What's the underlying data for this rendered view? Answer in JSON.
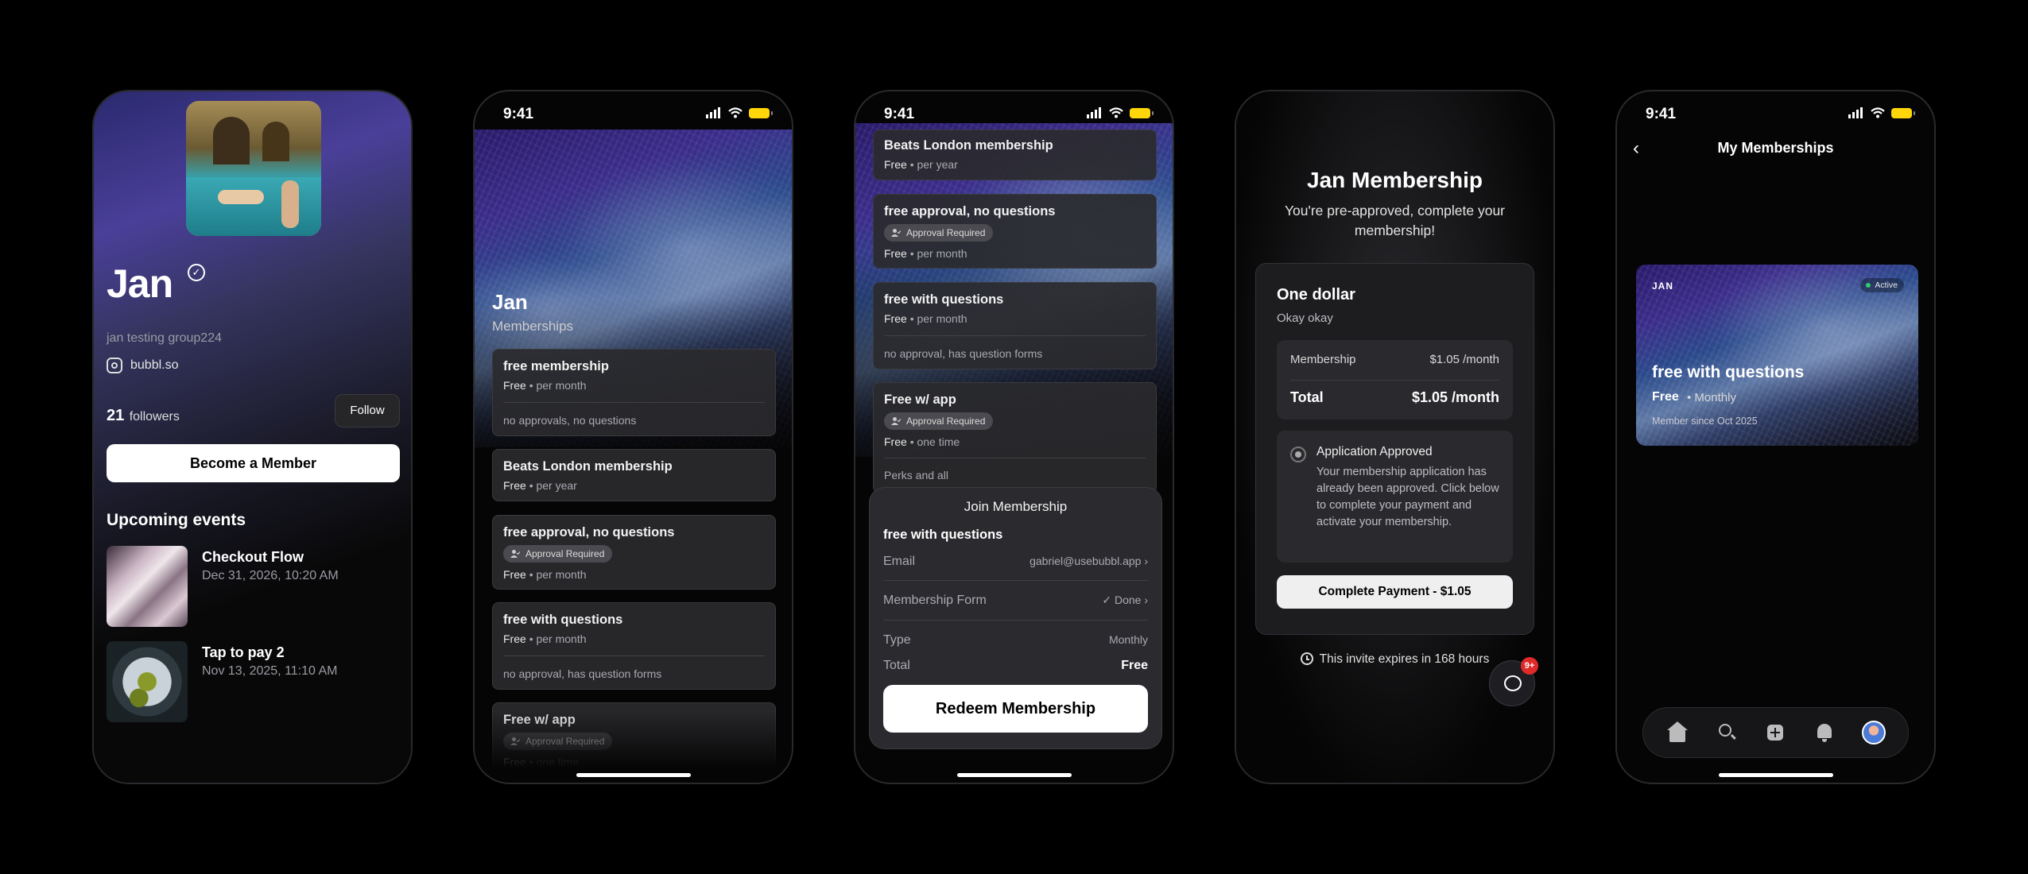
{
  "status": {
    "time": "9:41"
  },
  "profile": {
    "name": "Jan",
    "group": "jan testing group224",
    "link": "bubbl.so",
    "followers_count": "21",
    "followers_label": "followers",
    "follow_label": "Follow",
    "become_member_label": "Become a Member",
    "events_title": "Upcoming events",
    "events": [
      {
        "title": "Checkout Flow",
        "date": "Dec 31, 2026, 10:20 AM"
      },
      {
        "title": "Tap to pay 2",
        "date": "Nov 13, 2025, 11:10 AM"
      }
    ]
  },
  "memberships_page": {
    "title": "Jan",
    "subtitle": "Memberships",
    "plans": [
      {
        "name": "free membership",
        "price": "Free",
        "period": "• per month",
        "note": "no approvals, no questions"
      },
      {
        "name": "Beats London membership",
        "price": "Free",
        "period": "• per year"
      },
      {
        "name": "free approval, no questions",
        "badge": "Approval Required",
        "price": "Free",
        "period": "• per month"
      },
      {
        "name": "free with questions",
        "price": "Free",
        "period": "• per month",
        "note": "no approval, has question forms"
      },
      {
        "name": "Free w/ app",
        "badge": "Approval Required",
        "price": "Free",
        "period": "• one time",
        "note": "Perks and all"
      }
    ]
  },
  "join_sheet": {
    "title": "Join Membership",
    "plan": "free with questions",
    "email_label": "Email",
    "email_value": "gabriel@usebubbl.app",
    "form_label": "Membership Form",
    "form_value": "Done",
    "type_label": "Type",
    "type_value": "Monthly",
    "total_label": "Total",
    "total_value": "Free",
    "redeem_label": "Redeem Membership"
  },
  "checkout": {
    "title": "Jan Membership",
    "subtitle": "You're pre-approved, complete your membership!",
    "plan_name": "One dollar",
    "plan_desc": "Okay okay",
    "membership_label": "Membership",
    "membership_value": "$1.05 /month",
    "total_label": "Total",
    "total_value": "$1.05 /month",
    "approved_title": "Application Approved",
    "approved_body": "Your membership application has already been approved. Click below to complete your payment and activate your membership.",
    "pay_label": "Complete Payment - $1.05",
    "expire_text": "This invite expires in 168 hours",
    "notif_count": "9+"
  },
  "my_memberships": {
    "title": "My Memberships",
    "card": {
      "brand": "JAN",
      "status": "Active",
      "name": "free with questions",
      "price": "Free",
      "period": "• Monthly",
      "since": "Member since Oct 2025"
    }
  }
}
